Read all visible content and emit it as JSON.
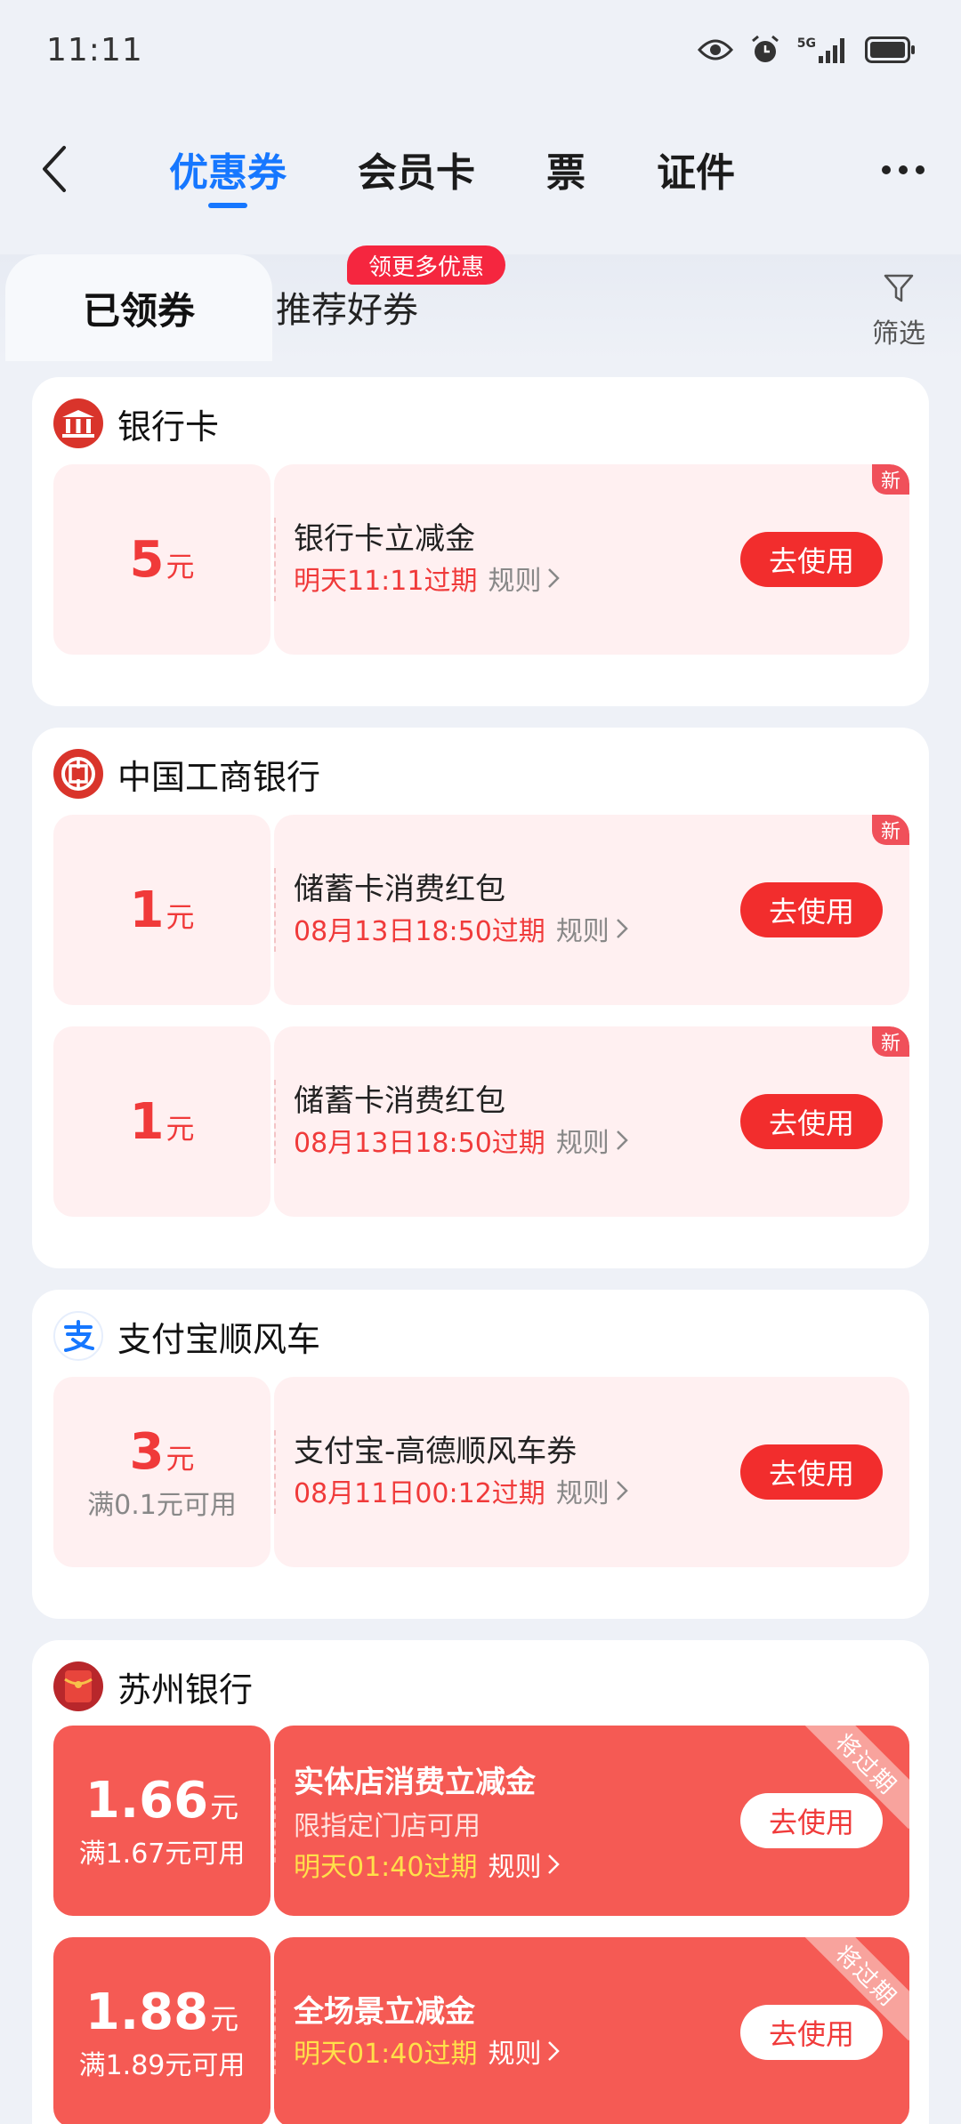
{
  "status_bar": {
    "time": "11:11",
    "network": "5G"
  },
  "nav": {
    "tabs": [
      {
        "label": "优惠券",
        "active": true
      },
      {
        "label": "会员卡",
        "active": false
      },
      {
        "label": "票",
        "active": false
      },
      {
        "label": "证件",
        "active": false
      }
    ]
  },
  "sub_tabs": {
    "claimed": "已领券",
    "recommended": "推荐好券",
    "promo_badge": "领更多优惠",
    "filter": "筛选"
  },
  "colors": {
    "accent": "#1677ff",
    "coupon_red": "#f22d2d",
    "expiring_bg": "#f55a54"
  },
  "groups": [
    {
      "name": "银行卡",
      "icon": "bank-card-icon",
      "coupons": [
        {
          "amount": "5",
          "unit": "元",
          "title": "银行卡立减金",
          "expiry": "明天11:11过期",
          "rule": "规则",
          "button": "去使用",
          "tag": "新"
        }
      ]
    },
    {
      "name": "中国工商银行",
      "icon": "icbc-logo-icon",
      "coupons": [
        {
          "amount": "1",
          "unit": "元",
          "title": "储蓄卡消费红包",
          "expiry": "08月13日18:50过期",
          "rule": "规则",
          "button": "去使用",
          "tag": "新"
        },
        {
          "amount": "1",
          "unit": "元",
          "title": "储蓄卡消费红包",
          "expiry": "08月13日18:50过期",
          "rule": "规则",
          "button": "去使用",
          "tag": "新"
        }
      ]
    },
    {
      "name": "支付宝顺风车",
      "icon": "alipay-logo-icon",
      "coupons": [
        {
          "amount": "3",
          "unit": "元",
          "threshold": "满0.1元可用",
          "title": "支付宝-高德顺风车券",
          "expiry": "08月11日00:12过期",
          "rule": "规则",
          "button": "去使用"
        }
      ]
    },
    {
      "name": "苏州银行",
      "icon": "red-envelope-icon",
      "coupons": [
        {
          "amount": "1.66",
          "unit": "元",
          "threshold": "满1.67元可用",
          "title": "实体店消费立减金",
          "desc": "限指定门店可用",
          "expiry": "明天01:40过期",
          "rule": "规则",
          "button": "去使用",
          "ribbon": "将过期"
        },
        {
          "amount": "1.88",
          "unit": "元",
          "threshold": "满1.89元可用",
          "title": "全场景立减金",
          "expiry": "明天01:40过期",
          "rule": "规则",
          "button": "去使用",
          "ribbon": "将过期"
        }
      ]
    }
  ]
}
